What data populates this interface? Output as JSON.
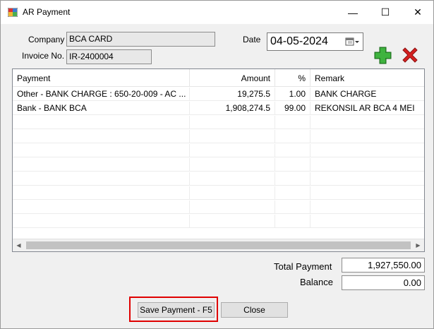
{
  "window": {
    "title": "AR Payment",
    "min_glyph": "—",
    "max_glyph": "☐",
    "close_glyph": "✕"
  },
  "form": {
    "company_label": "Company",
    "company_value": "BCA CARD",
    "invoice_label": "Invoice No.",
    "invoice_value": "IR-2400004",
    "date_label": "Date",
    "date_value": "04-05-2024"
  },
  "icons": {
    "add": "plus-icon",
    "delete": "x-icon",
    "add_color": "#2e9b2e",
    "delete_color": "#d62020"
  },
  "grid": {
    "columns": [
      "Payment",
      "Amount",
      "%",
      "Remark"
    ],
    "rows": [
      {
        "payment": "Other - BANK CHARGE : 650-20-009 - AC ...",
        "amount": "19,275.5",
        "percent": "1.00",
        "remark": "BANK CHARGE"
      },
      {
        "payment": "Bank - BANK BCA",
        "amount": "1,908,274.5",
        "percent": "99.00",
        "remark": "REKONSIL AR BCA 4 MEI"
      }
    ]
  },
  "totals": {
    "total_label": "Total Payment",
    "total_value": "1,927,550.00",
    "balance_label": "Balance",
    "balance_value": "0.00"
  },
  "buttons": {
    "save": "Save Payment - F5",
    "close": "Close"
  },
  "colors": {
    "highlight": "#e00000"
  }
}
